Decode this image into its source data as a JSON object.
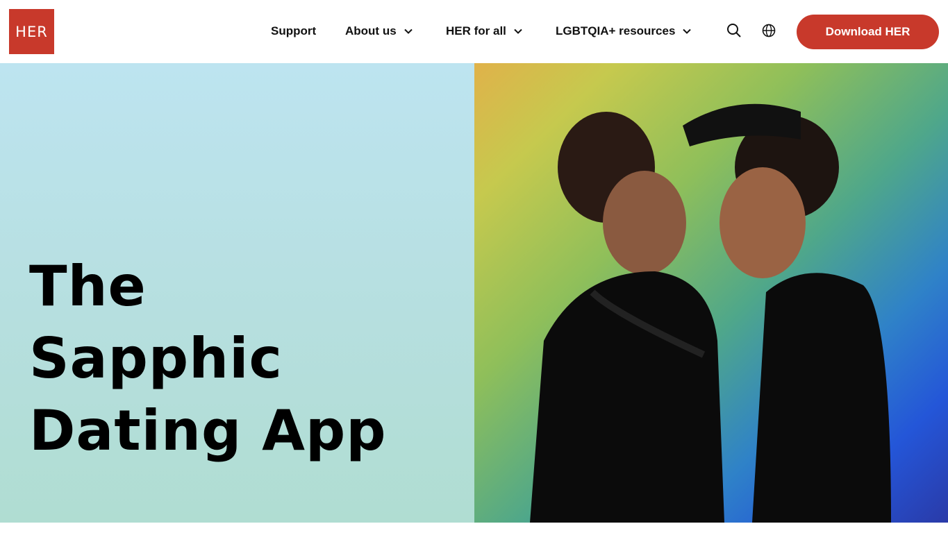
{
  "header": {
    "logo_text": "HER",
    "nav": {
      "support": "Support",
      "about": "About us",
      "her_for_all": "HER for all",
      "resources": "LGBTQIA+ resources"
    },
    "icons": [
      "search-icon",
      "globe-icon",
      "chevron-down-icon"
    ],
    "download_label": "Download HER"
  },
  "hero": {
    "title_lines": [
      "The",
      "Sapphic",
      "Dating App"
    ],
    "image_description_icon": "photo"
  },
  "colors": {
    "brand_red": "#c8392b",
    "hero_bg": "#b6dfdf",
    "text": "#111111"
  }
}
